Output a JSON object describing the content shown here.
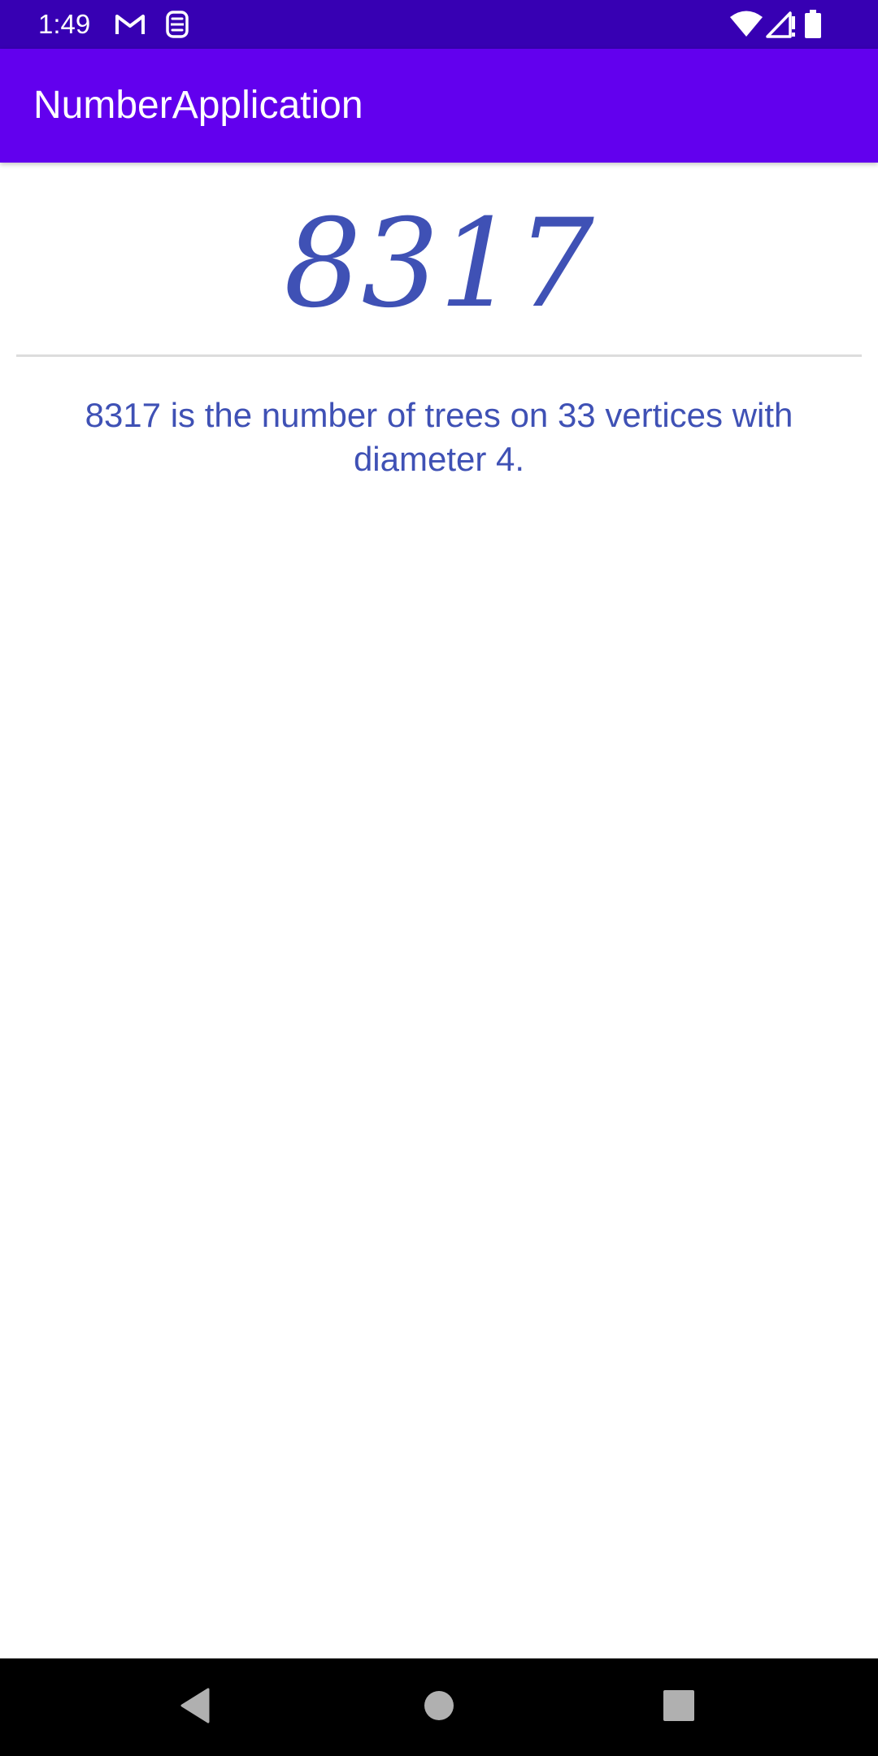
{
  "status_bar": {
    "time": "1:49",
    "left_icons": [
      "gmail-icon",
      "sim-storage-icon"
    ],
    "right_icons": [
      "wifi-icon",
      "cellular-signal-icon",
      "battery-icon"
    ],
    "background_color": "#3700b3"
  },
  "app_bar": {
    "title": "NumberApplication",
    "background_color": "#6200ee"
  },
  "main": {
    "number": "8317",
    "description": "8317 is the number of trees on 33 vertices with diameter 4.",
    "text_color": "#3f51b5"
  },
  "nav_bar": {
    "buttons": [
      "back-icon",
      "home-icon",
      "recents-icon"
    ]
  }
}
